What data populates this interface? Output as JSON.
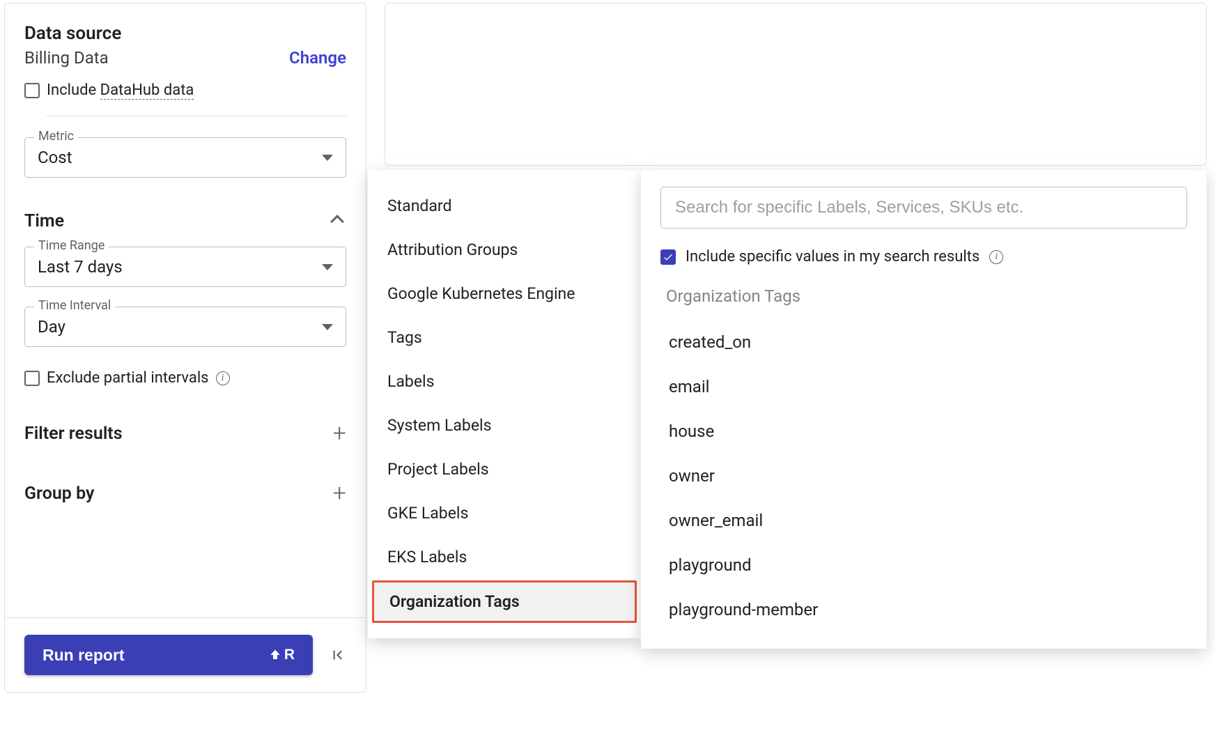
{
  "sidebar": {
    "data_source": {
      "title": "Data source",
      "value": "Billing Data",
      "change_label": "Change",
      "include_datahub_prefix": "Include ",
      "include_datahub_underlined": "DataHub data"
    },
    "metric": {
      "label": "Metric",
      "value": "Cost"
    },
    "time": {
      "title": "Time",
      "range_label": "Time Range",
      "range_value": "Last 7 days",
      "interval_label": "Time Interval",
      "interval_value": "Day",
      "exclude_label": "Exclude partial intervals"
    },
    "filter_title": "Filter results",
    "groupby_title": "Group by",
    "run_label": "Run report",
    "shortcut_key": "R"
  },
  "flyout": {
    "items": [
      "Standard",
      "Attribution Groups",
      "Google Kubernetes Engine",
      "Tags",
      "Labels",
      "System Labels",
      "Project Labels",
      "GKE Labels",
      "EKS Labels",
      "Organization Tags"
    ],
    "selected_index": 9
  },
  "results": {
    "search_placeholder": "Search for specific Labels, Services, SKUs etc.",
    "include_label": "Include specific values in my search results",
    "heading": "Organization Tags",
    "items": [
      "created_on",
      "email",
      "house",
      "owner",
      "owner_email",
      "playground",
      "playground-member"
    ]
  }
}
